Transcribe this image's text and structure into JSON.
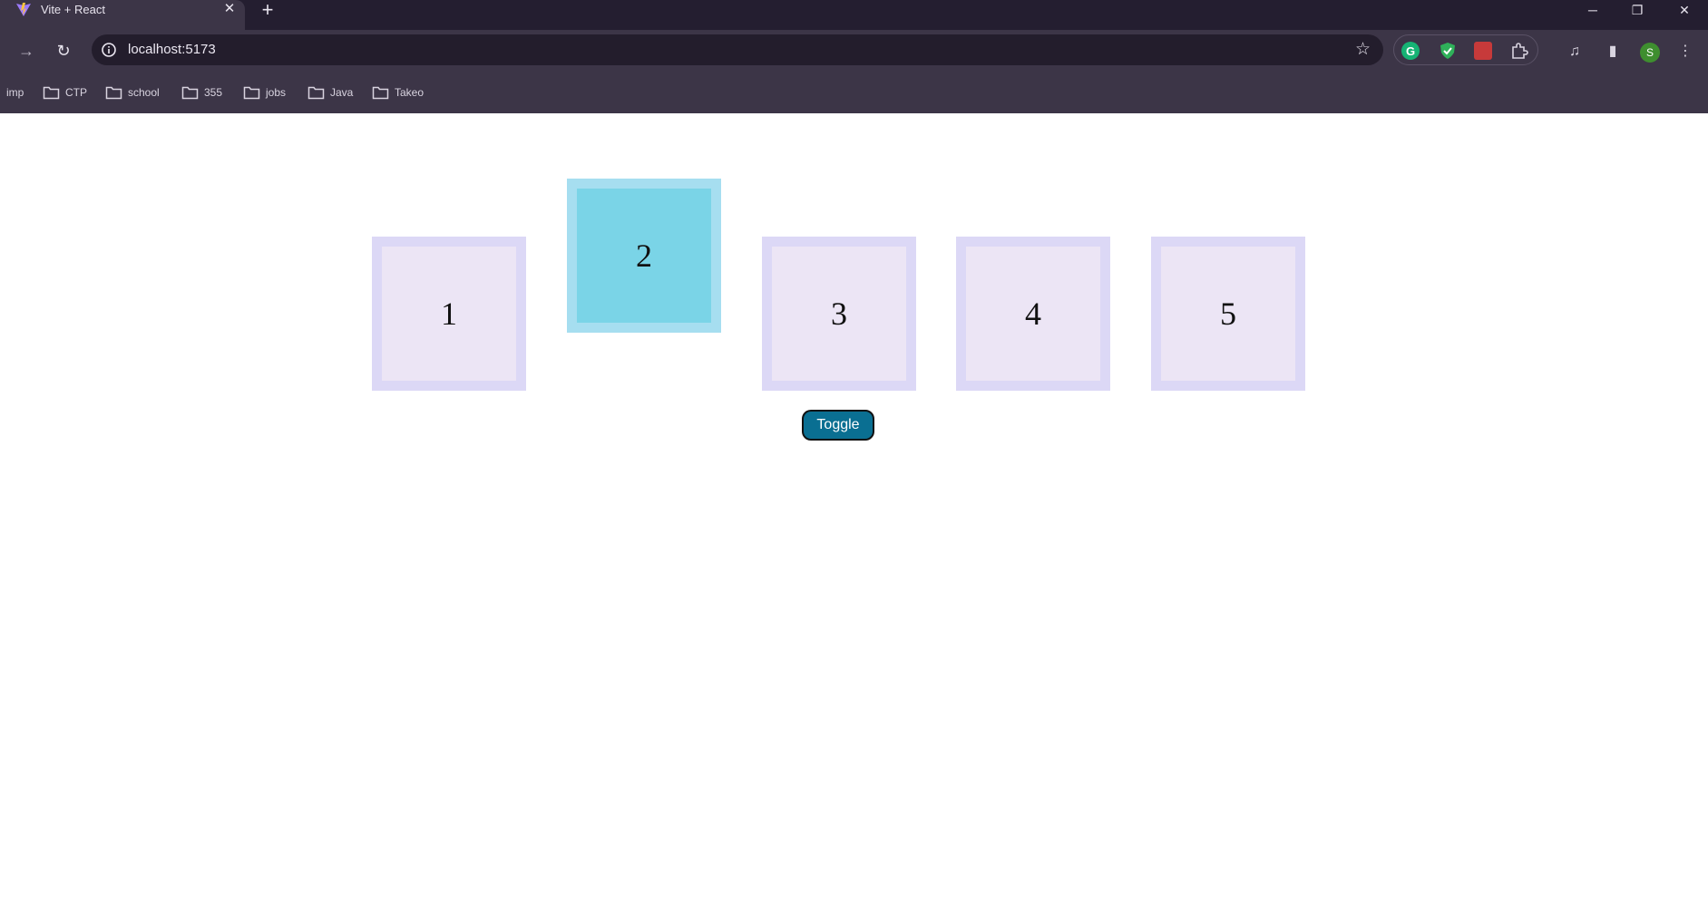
{
  "browser": {
    "tab": {
      "title": "Vite + React",
      "close_icon": "close-icon",
      "favicon": "vite-logo-icon"
    },
    "new_tab_icon": "plus-icon",
    "window_controls": [
      "minimize-icon",
      "restore-icon",
      "close-icon"
    ],
    "address_bar": {
      "url": "localhost:5173",
      "info_icon": "info-icon",
      "bookmark_icon": "star-icon"
    },
    "nav": {
      "back_icon": "back-arrow-icon",
      "forward_icon": "forward-arrow-icon",
      "reload_icon": "reload-icon"
    },
    "extensions": [
      "grammarly-icon",
      "shield-icon",
      "red-extension-icon",
      "puzzle-icon"
    ],
    "profile_initial": "S"
  },
  "bookmarks": {
    "items": [
      {
        "label": "imp",
        "folder": false
      },
      {
        "label": "CTP",
        "folder": true
      },
      {
        "label": "school",
        "folder": true
      },
      {
        "label": "355",
        "folder": true
      },
      {
        "label": "jobs",
        "folder": true
      },
      {
        "label": "Java",
        "folder": true
      },
      {
        "label": "Takeo",
        "folder": true
      }
    ]
  },
  "app": {
    "boxes": [
      {
        "label": "1",
        "active": false
      },
      {
        "label": "2",
        "active": true
      },
      {
        "label": "3",
        "active": false
      },
      {
        "label": "4",
        "active": false
      },
      {
        "label": "5",
        "active": false
      }
    ],
    "toggle_label": "Toggle"
  },
  "colors": {
    "box_border": "#dcd8f6",
    "box_fill": "#ece5f5",
    "active_border": "#a6def0",
    "active_fill": "#7ad4e7",
    "button": "#0a6f92"
  }
}
